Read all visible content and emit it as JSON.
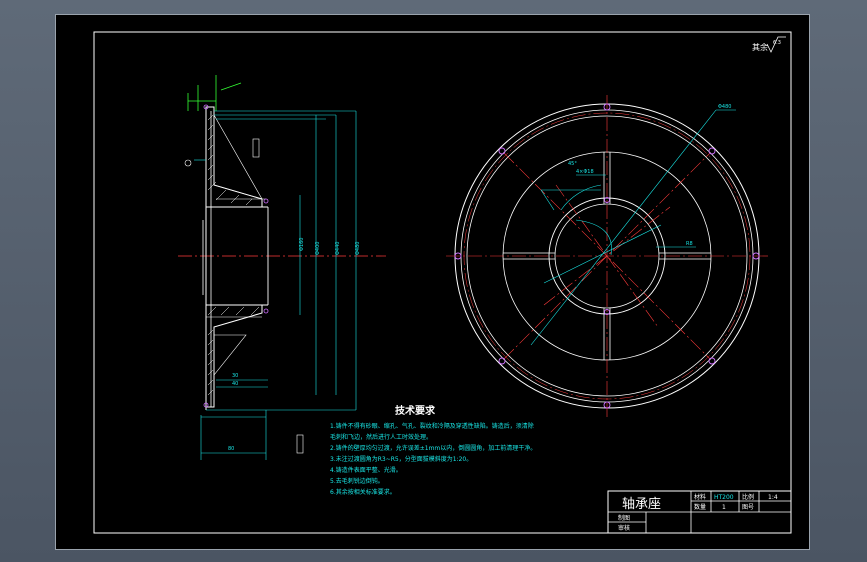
{
  "drawing": {
    "corner_note": "其余",
    "roughness_value": "6.3",
    "title": "轴承座",
    "material_label": "材料",
    "material_value": "HT200",
    "scale_label": "比例",
    "scale_value": "1:4",
    "quantity_label": "数量",
    "quantity_value": "1",
    "sheet_label": "图号",
    "drawn_label": "制图",
    "checked_label": "审核"
  },
  "tech": {
    "heading": "技术要求",
    "lines": [
      "1.铸件不得有砂眼、缩孔、气孔、裂纹和冷隔及穿透性缺陷。铸造后，须清除",
      "  毛刺和飞边，然后进行人工时效处理。",
      "2.铸件的壁厚均匀过渡，允许误差±1mm以内，倒圆圆角，加工前清理干净。",
      "3.未注过渡圆角为R3~R5，分型面拔模斜度为1:20。",
      "4.铸造件表面平整、光滑。",
      "5.去毛刺锐边倒钝。",
      "6.其余按相关标准要求。"
    ]
  },
  "colors": {
    "background": "#000000",
    "outline": "#ffffff",
    "centerline": "#ff3b3b",
    "dimension": "#19e6e6",
    "accent": "#33ff33",
    "hole": "#d070ff"
  }
}
